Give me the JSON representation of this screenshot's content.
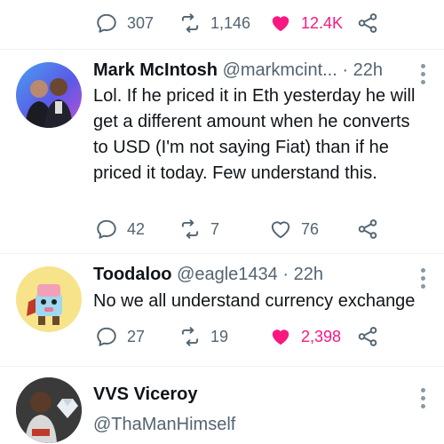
{
  "top_actions": {
    "replies": "307",
    "retweets": "1,146",
    "likes": "12.4K",
    "liked": true
  },
  "tweets": [
    {
      "name": "Mark McIntosh",
      "handle": "@markmcint...",
      "time": "· 22h",
      "text": "Lol. If he priced it in Eth yesterday he will get a different amount when he converts to USD (I'm not saying Fiat) than if he priced it today. Few understand this.",
      "replies": "42",
      "retweets": "7",
      "likes": "76",
      "liked": false
    },
    {
      "name": "Toodaloo",
      "handle": "@eagle1434",
      "time": "· 22h",
      "text": "No we all understand currency exchange",
      "replies": "27",
      "retweets": "19",
      "likes": "2,398",
      "liked": true
    },
    {
      "name": "VVS Viceroy",
      "handle": "@ThaManHimself"
    }
  ],
  "colors": {
    "like": "#f91880",
    "muted": "#536471",
    "text": "#0f1419"
  },
  "icons": [
    "reply-icon",
    "retweet-icon",
    "heart-icon",
    "share-icon",
    "more-icon"
  ]
}
